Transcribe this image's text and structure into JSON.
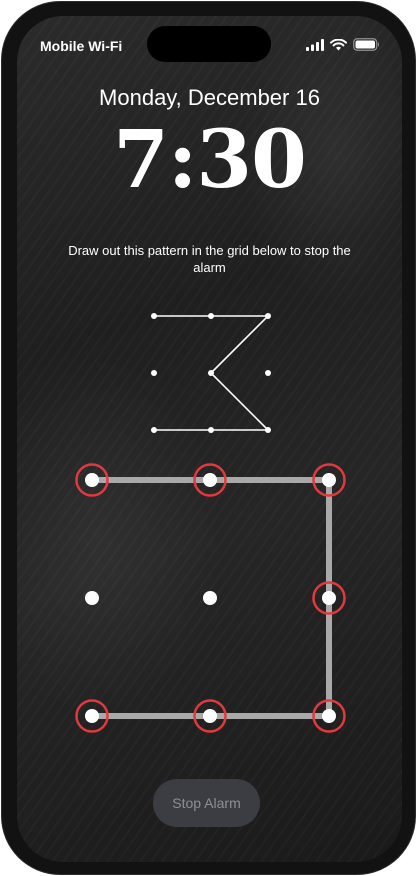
{
  "status_bar": {
    "carrier": "Mobile Wi-Fi",
    "icons": [
      "cellular-signal-icon",
      "wifi-icon",
      "battery-icon"
    ]
  },
  "lock_screen": {
    "date": "Monday, December 16",
    "time": "7:30"
  },
  "alarm": {
    "instruction": "Draw out this pattern in the grid below to stop the alarm",
    "stop_button_label": "Stop Alarm"
  },
  "reference_pattern": {
    "grid": "3x3",
    "sequence": [
      1,
      2,
      3,
      5,
      9,
      8,
      7
    ]
  },
  "input_grid": {
    "grid": "3x3",
    "drawn_sequence": [
      1,
      2,
      3,
      6,
      9,
      8,
      7
    ],
    "selected_color": "#e0393e",
    "line_color": "#a9a9a9"
  },
  "colors": {
    "background": "#1f1f1f",
    "button_bg": "#3b3d42",
    "button_text": "#8c8f96"
  }
}
